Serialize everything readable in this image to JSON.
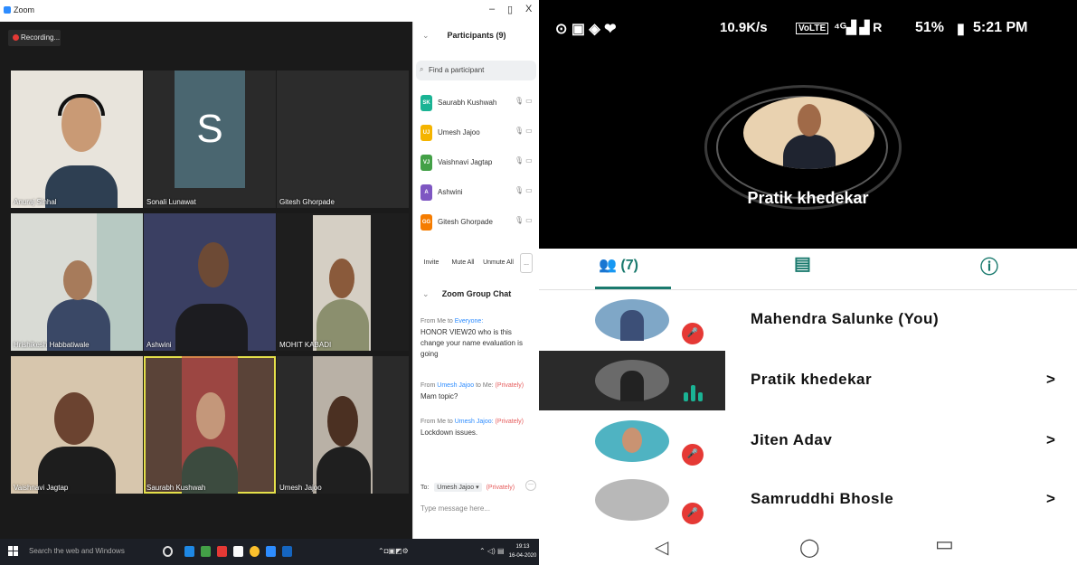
{
  "zoom": {
    "window_title": "Zoom",
    "window_controls": [
      "–",
      "▯",
      "X"
    ],
    "recording_label": "Recording...",
    "tiles": [
      {
        "name": "Anuraj Sinhal"
      },
      {
        "name": "Sonali Lunawat",
        "initial": "S"
      },
      {
        "name": "Gitesh Ghorpade"
      },
      {
        "name": "Hrishikesh Habbatiwale"
      },
      {
        "name": "Ashwini"
      },
      {
        "name": "MOHIT KABADI"
      },
      {
        "name": "Vaishnavi Jagtap"
      },
      {
        "name": "Saurabh Kushwah"
      },
      {
        "name": "Umesh Jajoo"
      }
    ],
    "participants": {
      "title": "Participants (9)",
      "search_placeholder": "Find a participant",
      "list": [
        {
          "initials": "SK",
          "name": "Saurabh Kushwah",
          "color": "#1ab394"
        },
        {
          "initials": "UJ",
          "name": "Umesh Jajoo",
          "color": "#f4b400"
        },
        {
          "initials": "VJ",
          "name": "Vaishnavi Jagtap",
          "color": "#43a047"
        },
        {
          "initials": "A",
          "name": "Ashwini",
          "color": "#7e57c2"
        },
        {
          "initials": "GG",
          "name": "Gitesh Ghorpade",
          "color": "#f57c00"
        }
      ],
      "buttons": [
        "Invite",
        "Mute All",
        "Unmute All",
        "..."
      ]
    },
    "chat": {
      "title": "Zoom Group Chat",
      "messages": [
        {
          "from": "From Me to",
          "to": "Everyone:",
          "private": "",
          "text": "HONOR VIEW20 who is this change your name evaluation is going"
        },
        {
          "from": "From",
          "sender": "Umesh Jajoo",
          "to": "to Me:",
          "private": "(Privately)",
          "text": "Mam topic?"
        },
        {
          "from": "From Me to",
          "to": "Umesh Jajoo:",
          "private": "(Privately)",
          "text": "Lockdown issues."
        }
      ],
      "to_label": "To:",
      "to_value": "Umesh Jajoo ▾",
      "to_private": "(Privately)",
      "input_placeholder": "Type message here..."
    },
    "taskbar": {
      "search_placeholder": "Search the web and Windows",
      "time": "19:13",
      "date": "16-04-2020"
    }
  },
  "phone": {
    "status": {
      "left_icons": "⊙ ▣ ◈ ❤",
      "net_speed": "10.9K/s",
      "carrier": "VoLTE",
      "signal": "⁴ᴳ▟ ▟ R",
      "battery": "51%",
      "battery_icon": "▮",
      "time": "5:21 PM"
    },
    "active_speaker": "Pratik khedekar",
    "tabs": {
      "participants_count": "(7)"
    },
    "participants": [
      {
        "name": "Mahendra Salunke (You)",
        "muted": true,
        "arrow": false
      },
      {
        "name": "Pratik khedekar",
        "muted": false,
        "speaking": true,
        "arrow": true
      },
      {
        "name": "Jiten Adav",
        "muted": true,
        "arrow": true
      },
      {
        "name": "Samruddhi Bhosle",
        "muted": true,
        "arrow": true
      }
    ],
    "arrow_glyph": ">",
    "nav": {
      "back": "◁",
      "home": "◯",
      "recent": "▭"
    }
  }
}
